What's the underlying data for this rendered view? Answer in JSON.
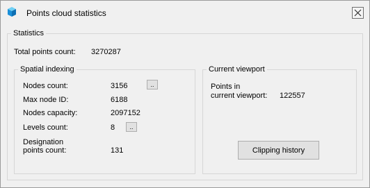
{
  "window": {
    "title": "Points cloud statistics"
  },
  "statistics": {
    "label": "Statistics",
    "total_points_label": "Total points count:",
    "total_points_value": "3270287"
  },
  "spatial": {
    "label": "Spatial indexing",
    "nodes_count_label": "Nodes count:",
    "nodes_count_value": "3156",
    "max_node_label": "Max node ID:",
    "max_node_value": "6188",
    "capacity_label": "Nodes capacity:",
    "capacity_value": "2097152",
    "levels_label": "Levels count:",
    "levels_value": "8",
    "designation_label_1": "Designation",
    "designation_label_2": "points count:",
    "designation_value": "131",
    "more_button": ".."
  },
  "viewport": {
    "label": "Current viewport",
    "points_label_1": "Points in",
    "points_label_2": "current viewport:",
    "points_value": "122557",
    "clipping_button": "Clipping  history"
  }
}
